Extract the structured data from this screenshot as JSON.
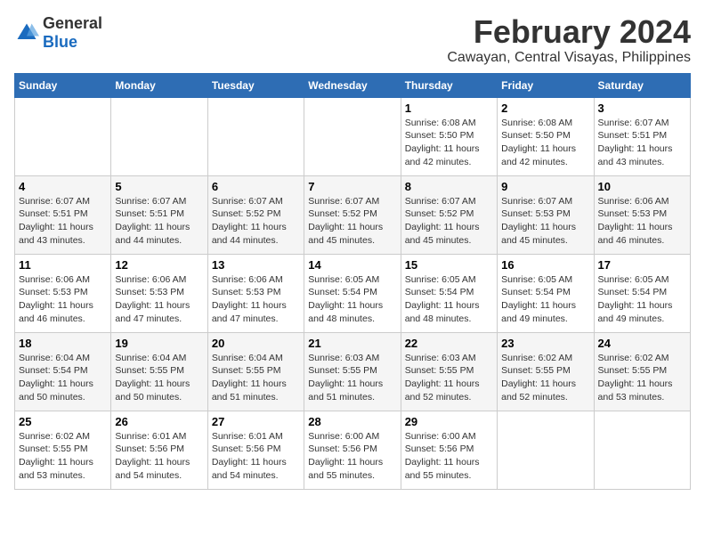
{
  "logo": {
    "general": "General",
    "blue": "Blue"
  },
  "title": "February 2024",
  "subtitle": "Cawayan, Central Visayas, Philippines",
  "weekdays": [
    "Sunday",
    "Monday",
    "Tuesday",
    "Wednesday",
    "Thursday",
    "Friday",
    "Saturday"
  ],
  "weeks": [
    [
      {
        "day": "",
        "info": ""
      },
      {
        "day": "",
        "info": ""
      },
      {
        "day": "",
        "info": ""
      },
      {
        "day": "",
        "info": ""
      },
      {
        "day": "1",
        "info": "Sunrise: 6:08 AM\nSunset: 5:50 PM\nDaylight: 11 hours and 42 minutes."
      },
      {
        "day": "2",
        "info": "Sunrise: 6:08 AM\nSunset: 5:50 PM\nDaylight: 11 hours and 42 minutes."
      },
      {
        "day": "3",
        "info": "Sunrise: 6:07 AM\nSunset: 5:51 PM\nDaylight: 11 hours and 43 minutes."
      }
    ],
    [
      {
        "day": "4",
        "info": "Sunrise: 6:07 AM\nSunset: 5:51 PM\nDaylight: 11 hours and 43 minutes."
      },
      {
        "day": "5",
        "info": "Sunrise: 6:07 AM\nSunset: 5:51 PM\nDaylight: 11 hours and 44 minutes."
      },
      {
        "day": "6",
        "info": "Sunrise: 6:07 AM\nSunset: 5:52 PM\nDaylight: 11 hours and 44 minutes."
      },
      {
        "day": "7",
        "info": "Sunrise: 6:07 AM\nSunset: 5:52 PM\nDaylight: 11 hours and 45 minutes."
      },
      {
        "day": "8",
        "info": "Sunrise: 6:07 AM\nSunset: 5:52 PM\nDaylight: 11 hours and 45 minutes."
      },
      {
        "day": "9",
        "info": "Sunrise: 6:07 AM\nSunset: 5:53 PM\nDaylight: 11 hours and 45 minutes."
      },
      {
        "day": "10",
        "info": "Sunrise: 6:06 AM\nSunset: 5:53 PM\nDaylight: 11 hours and 46 minutes."
      }
    ],
    [
      {
        "day": "11",
        "info": "Sunrise: 6:06 AM\nSunset: 5:53 PM\nDaylight: 11 hours and 46 minutes."
      },
      {
        "day": "12",
        "info": "Sunrise: 6:06 AM\nSunset: 5:53 PM\nDaylight: 11 hours and 47 minutes."
      },
      {
        "day": "13",
        "info": "Sunrise: 6:06 AM\nSunset: 5:53 PM\nDaylight: 11 hours and 47 minutes."
      },
      {
        "day": "14",
        "info": "Sunrise: 6:05 AM\nSunset: 5:54 PM\nDaylight: 11 hours and 48 minutes."
      },
      {
        "day": "15",
        "info": "Sunrise: 6:05 AM\nSunset: 5:54 PM\nDaylight: 11 hours and 48 minutes."
      },
      {
        "day": "16",
        "info": "Sunrise: 6:05 AM\nSunset: 5:54 PM\nDaylight: 11 hours and 49 minutes."
      },
      {
        "day": "17",
        "info": "Sunrise: 6:05 AM\nSunset: 5:54 PM\nDaylight: 11 hours and 49 minutes."
      }
    ],
    [
      {
        "day": "18",
        "info": "Sunrise: 6:04 AM\nSunset: 5:54 PM\nDaylight: 11 hours and 50 minutes."
      },
      {
        "day": "19",
        "info": "Sunrise: 6:04 AM\nSunset: 5:55 PM\nDaylight: 11 hours and 50 minutes."
      },
      {
        "day": "20",
        "info": "Sunrise: 6:04 AM\nSunset: 5:55 PM\nDaylight: 11 hours and 51 minutes."
      },
      {
        "day": "21",
        "info": "Sunrise: 6:03 AM\nSunset: 5:55 PM\nDaylight: 11 hours and 51 minutes."
      },
      {
        "day": "22",
        "info": "Sunrise: 6:03 AM\nSunset: 5:55 PM\nDaylight: 11 hours and 52 minutes."
      },
      {
        "day": "23",
        "info": "Sunrise: 6:02 AM\nSunset: 5:55 PM\nDaylight: 11 hours and 52 minutes."
      },
      {
        "day": "24",
        "info": "Sunrise: 6:02 AM\nSunset: 5:55 PM\nDaylight: 11 hours and 53 minutes."
      }
    ],
    [
      {
        "day": "25",
        "info": "Sunrise: 6:02 AM\nSunset: 5:55 PM\nDaylight: 11 hours and 53 minutes."
      },
      {
        "day": "26",
        "info": "Sunrise: 6:01 AM\nSunset: 5:56 PM\nDaylight: 11 hours and 54 minutes."
      },
      {
        "day": "27",
        "info": "Sunrise: 6:01 AM\nSunset: 5:56 PM\nDaylight: 11 hours and 54 minutes."
      },
      {
        "day": "28",
        "info": "Sunrise: 6:00 AM\nSunset: 5:56 PM\nDaylight: 11 hours and 55 minutes."
      },
      {
        "day": "29",
        "info": "Sunrise: 6:00 AM\nSunset: 5:56 PM\nDaylight: 11 hours and 55 minutes."
      },
      {
        "day": "",
        "info": ""
      },
      {
        "day": "",
        "info": ""
      }
    ]
  ]
}
